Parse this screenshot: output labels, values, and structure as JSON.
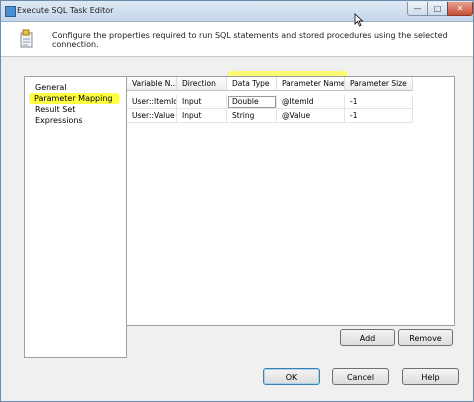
{
  "window": {
    "title": "Execute SQL Task Editor"
  },
  "caption_buttons": {
    "minimize": "—",
    "maximize": "□",
    "close": "✕"
  },
  "header": {
    "description": "Configure the properties required to run SQL statements and stored procedures using the selected connection."
  },
  "nav": {
    "items": [
      {
        "label": "General"
      },
      {
        "label": "Parameter Mapping",
        "selected": true
      },
      {
        "label": "Result Set"
      },
      {
        "label": "Expressions"
      }
    ]
  },
  "grid": {
    "columns": [
      "Variable N...",
      "Direction",
      "Data Type",
      "Parameter Name",
      "Parameter Size"
    ],
    "rows": [
      [
        "User::ItemId",
        "Input",
        "Double",
        "@ItemId",
        "-1"
      ],
      [
        "User::Value",
        "Input",
        "String",
        "@Value",
        "-1"
      ]
    ]
  },
  "buttons": {
    "add": "Add",
    "remove": "Remove",
    "ok": "OK",
    "cancel": "Cancel",
    "help": "Help"
  },
  "colors": {
    "highlight": "#ffff44",
    "title_bar": "#c5d6ea"
  }
}
